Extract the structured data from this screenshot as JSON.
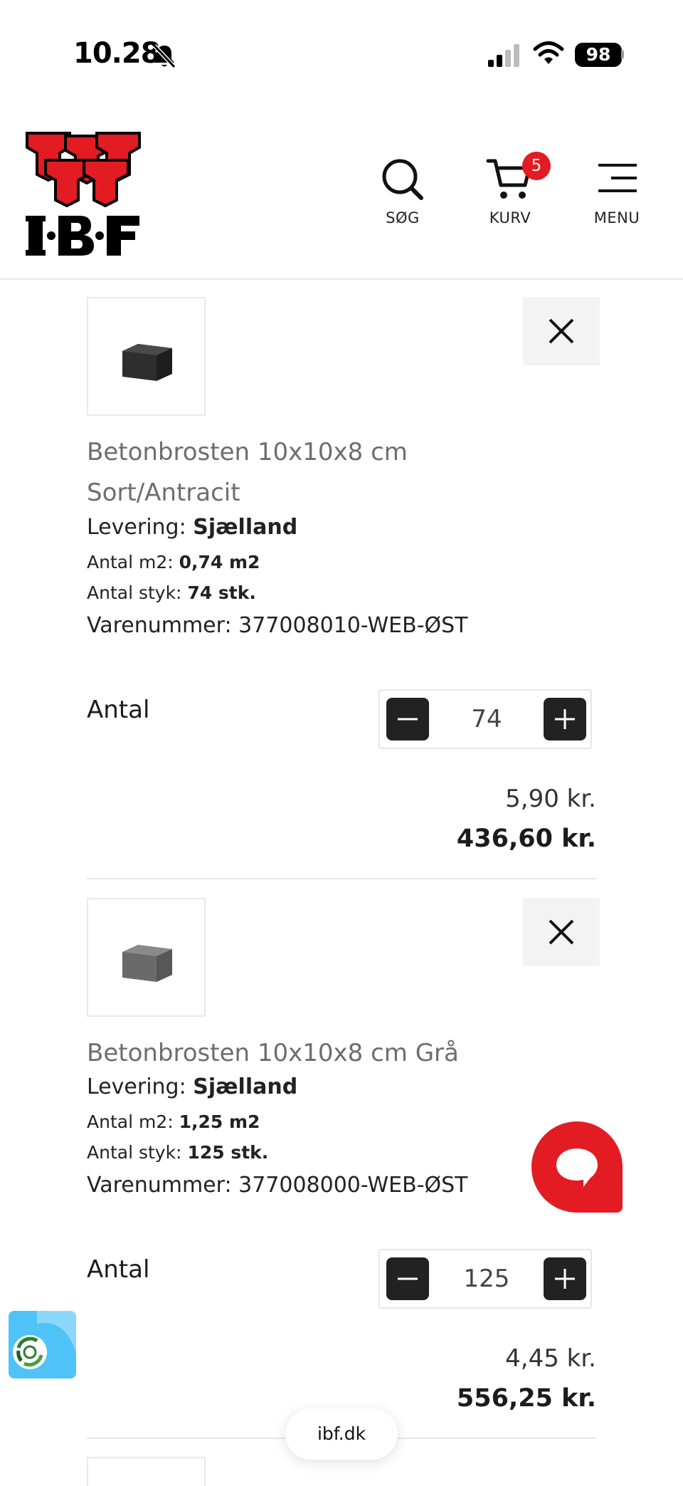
{
  "status_bar": {
    "time": "10.28",
    "battery": "98"
  },
  "header": {
    "logo_text": "I·B·F",
    "search_label": "SØG",
    "cart_label": "KURV",
    "cart_count": "5",
    "menu_label": "MENU",
    "accent_color": "#e31b23"
  },
  "cart": {
    "items": [
      {
        "name": "Betonbrosten 10x10x8 cm Sort/Antracit",
        "delivery_label": "Levering:",
        "delivery_value": "Sjælland",
        "m2_label": "Antal m2:",
        "m2_value": "0,74 m2",
        "pieces_label": "Antal styk:",
        "pieces_value": "74 stk.",
        "sku_label": "Varenummer:",
        "sku_value": "377008010-WEB-ØST",
        "qty_label": "Antal",
        "qty": "74",
        "unit_price": "5,90 kr.",
        "total": "436,60 kr."
      },
      {
        "name": "Betonbrosten 10x10x8 cm Grå",
        "delivery_label": "Levering:",
        "delivery_value": "Sjælland",
        "m2_label": "Antal m2:",
        "m2_value": "1,25 m2",
        "pieces_label": "Antal styk:",
        "pieces_value": "125 stk.",
        "sku_label": "Varenummer:",
        "sku_value": "377008000-WEB-ØST",
        "qty_label": "Antal",
        "qty": "125",
        "unit_price": "4,45 kr.",
        "total": "556,25 kr."
      }
    ]
  },
  "browser": {
    "url": "ibf.dk"
  }
}
